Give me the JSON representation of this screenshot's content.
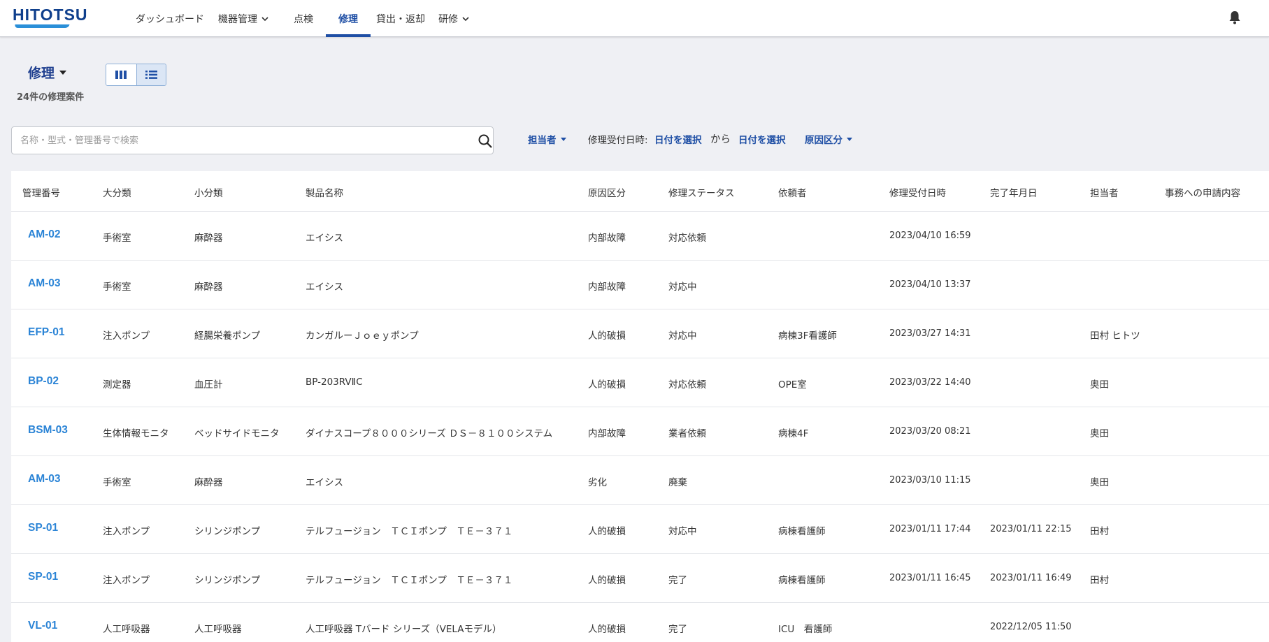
{
  "brand": {
    "logo": "HITOTSU"
  },
  "nav": [
    {
      "label": "ダッシュボード"
    },
    {
      "label": "機器管理"
    },
    {
      "label": "点検"
    },
    {
      "label": "修理"
    },
    {
      "label": "貸出・返却"
    },
    {
      "label": "研修"
    }
  ],
  "header": {
    "title": "修理",
    "count": "24件の修理案件"
  },
  "filters": {
    "search_placeholder": "名称・型式・管理番号で検索",
    "assignee": "担当者",
    "received_label": "修理受付日時:",
    "date_from": "日付を選択",
    "from_word": "から",
    "date_to": "日付を選択",
    "cause": "原因区分"
  },
  "table": {
    "columns": [
      "管理番号",
      "大分類",
      "小分類",
      "製品名称",
      "原因区分",
      "修理ステータス",
      "依頼者",
      "修理受付日時",
      "完了年月日",
      "担当者",
      "事務への申請内容"
    ],
    "rows": [
      {
        "id": "AM-02",
        "major": "手術室",
        "minor": "麻酔器",
        "product": "エイシス",
        "cause": "内部故障",
        "status": "対応依頼",
        "requester": "",
        "received": "2023/04/10 16:59",
        "completed": "",
        "assignee": "",
        "office": ""
      },
      {
        "id": "AM-03",
        "major": "手術室",
        "minor": "麻酔器",
        "product": "エイシス",
        "cause": "内部故障",
        "status": "対応中",
        "requester": "",
        "received": "2023/04/10 13:37",
        "completed": "",
        "assignee": "",
        "office": ""
      },
      {
        "id": "EFP-01",
        "major": "注入ポンプ",
        "minor": "経腸栄養ポンプ",
        "product": "カンガルーＪｏｅｙポンプ",
        "cause": "人的破損",
        "status": "対応中",
        "requester": "病棟3F看護師",
        "received": "2023/03/27 14:31",
        "completed": "",
        "assignee": "田村 ヒトツ",
        "office": ""
      },
      {
        "id": "BP-02",
        "major": "測定器",
        "minor": "血圧計",
        "product": "BP-203RVⅡC",
        "cause": "人的破損",
        "status": "対応依頼",
        "requester": "OPE室",
        "received": "2023/03/22 14:40",
        "completed": "",
        "assignee": "奥田",
        "office": ""
      },
      {
        "id": "BSM-03",
        "major": "生体情報モニタ",
        "minor": "ベッドサイドモニタ",
        "product": "ダイナスコープ８０００シリーズ ＤＳ－８１００システム",
        "cause": "内部故障",
        "status": "業者依頼",
        "requester": "病棟4F",
        "received": "2023/03/20 08:21",
        "completed": "",
        "assignee": "奥田",
        "office": ""
      },
      {
        "id": "AM-03",
        "major": "手術室",
        "minor": "麻酔器",
        "product": "エイシス",
        "cause": "劣化",
        "status": "廃棄",
        "requester": "",
        "received": "2023/03/10 11:15",
        "completed": "",
        "assignee": "奥田",
        "office": ""
      },
      {
        "id": "SP-01",
        "major": "注入ポンプ",
        "minor": "シリンジポンプ",
        "product": "テルフュージョン　ＴＣＩポンプ　ＴＥ－３７１",
        "cause": "人的破損",
        "status": "対応中",
        "requester": "病棟看護師",
        "received": "2023/01/11 17:44",
        "completed": "2023/01/11 22:15",
        "assignee": "田村",
        "office": ""
      },
      {
        "id": "SP-01",
        "major": "注入ポンプ",
        "minor": "シリンジポンプ",
        "product": "テルフュージョン　ＴＣＩポンプ　ＴＥ－３７１",
        "cause": "人的破損",
        "status": "完了",
        "requester": "病棟看護師",
        "received": "2023/01/11 16:45",
        "completed": "2023/01/11 16:49",
        "assignee": "田村",
        "office": ""
      },
      {
        "id": "VL-01",
        "major": "人工呼吸器",
        "minor": "人工呼吸器",
        "product": "人工呼吸器 Tバード シリーズ（VELAモデル）",
        "cause": "人的破損",
        "status": "完了",
        "requester": "ICU　看護師",
        "received": "",
        "completed": "2022/12/05 11:50",
        "assignee": "",
        "office": ""
      }
    ]
  },
  "colors": {
    "primary": "#1f4fa5",
    "link": "#2b84d6",
    "background": "#eff0f4"
  },
  "icons": {
    "bell": "bell-icon",
    "search": "search-icon",
    "grid_view": "columns-icon",
    "list_view": "list-icon"
  }
}
